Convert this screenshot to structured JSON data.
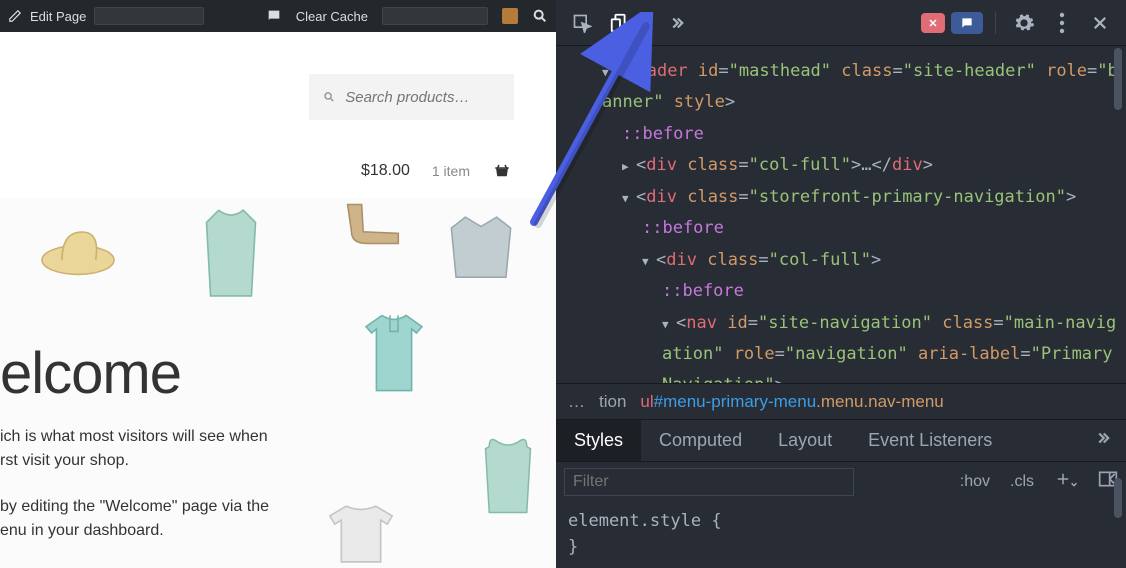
{
  "admin_bar": {
    "edit_label": "Edit Page",
    "clear_cache_label": "Clear Cache"
  },
  "site": {
    "search_placeholder": "Search products…",
    "cart_price": "$18.00",
    "cart_items": "1 item",
    "hero_title": "elcome",
    "hero_line1": "ich is what most visitors will see when",
    "hero_line2": "rst visit your shop.",
    "hero_line3": "by editing the \"Welcome\" page via the",
    "hero_line4": "enu in your dashboard."
  },
  "devtools": {
    "dom": {
      "header_tag": "header",
      "header_id": "masthead",
      "header_class": "site-header",
      "header_role": "banner",
      "header_style_attr": "style",
      "before": "::before",
      "div_tag": "div",
      "col_full": "col-full",
      "storefront_nav": "storefront-primary-navigation",
      "nav_tag": "nav",
      "nav_id": "site-navigation",
      "nav_class": "main-navigation",
      "nav_role": "navigation",
      "nav_aria": "aria-label",
      "nav_aria_val": "Primary Navigation"
    },
    "breadcrumb": {
      "ellipsis": "…",
      "trunc": "tion",
      "el": "ul",
      "id": "#menu-primary-menu",
      "cls": ".menu.nav-menu"
    },
    "tabs": {
      "styles": "Styles",
      "computed": "Computed",
      "layout": "Layout",
      "listeners": "Event Listeners"
    },
    "filter": {
      "placeholder": "Filter",
      "hov": ":hov",
      "cls": ".cls"
    },
    "style_rule_selector": "element.style",
    "style_rule_open": "{",
    "style_rule_close": "}"
  }
}
